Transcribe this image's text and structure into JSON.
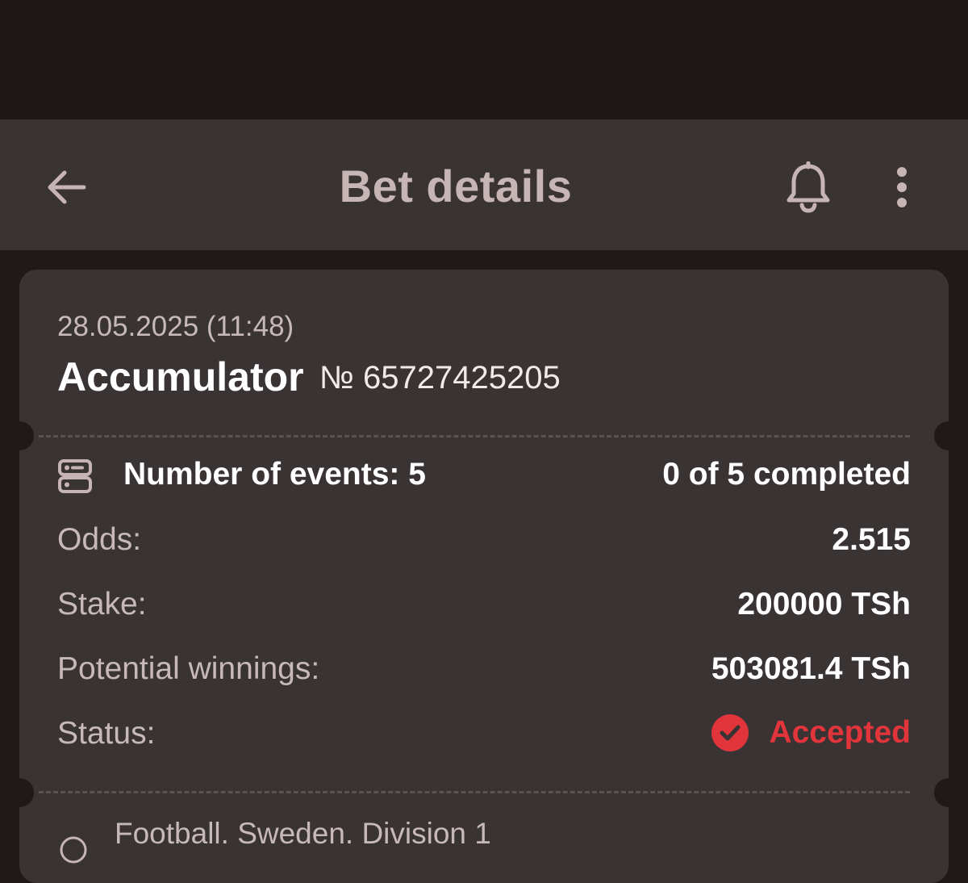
{
  "header": {
    "title": "Bet details",
    "back_icon": "arrow-left-icon",
    "bell_icon": "bell-icon",
    "more_icon": "more-vertical-icon"
  },
  "bet": {
    "date": "28.05.2025 (11:48)",
    "type": "Accumulator",
    "number": "№ 65727425205",
    "events_label": "Number of events: 5",
    "events_progress": "0 of 5 completed",
    "odds_label": "Odds:",
    "odds_value": "2.515",
    "stake_label": "Stake:",
    "stake_value": "200000 TSh",
    "winnings_label": "Potential winnings:",
    "winnings_value": "503081.4 TSh",
    "status_label": "Status:",
    "status_value": "Accepted"
  },
  "event": {
    "sport": "Football. Sweden. Division 1"
  },
  "colors": {
    "background": "#201919",
    "surface": "#3a3333",
    "title": "#c7b5b5",
    "accent_red": "#e1343b"
  }
}
